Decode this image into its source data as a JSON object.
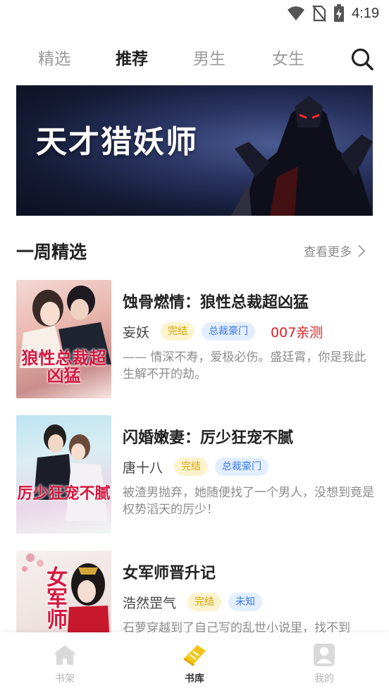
{
  "status_bar": {
    "time": "4:19"
  },
  "tabs": [
    {
      "label": "精选",
      "active": false
    },
    {
      "label": "推荐",
      "active": true
    },
    {
      "label": "男生",
      "active": false
    },
    {
      "label": "女生",
      "active": false
    }
  ],
  "banner": {
    "title": "天才猎妖师"
  },
  "section": {
    "title": "一周精选",
    "more_label": "查看更多"
  },
  "books": [
    {
      "title": "蚀骨燃情：狼性总裁超凶猛",
      "author": "妄妖",
      "status_tag": "完结",
      "category_tag": "总裁豪门",
      "note": "007亲测",
      "description": "—— 情深不寿，爱极必伤。盛廷霄，你是我此生解不开的劫。",
      "cover_text": "狼性总裁超凶猛"
    },
    {
      "title": "闪婚嫩妻：厉少狂宠不腻",
      "author": "唐十八",
      "status_tag": "完结",
      "category_tag": "总裁豪门",
      "note": "",
      "description": "被渣男抛弃，她随便找了一个男人，没想到竟是权势滔天的厉少！",
      "cover_text": "厉少狂宠不腻"
    },
    {
      "title": "女军师晋升记",
      "author": "浩然罡气",
      "status_tag": "完结",
      "category_tag": "未知",
      "note": "",
      "description": "石萝穿越到了自己写的乱世小说里，找不到",
      "cover_text": "女军师"
    }
  ],
  "bottom_nav": [
    {
      "label": "书架",
      "icon": "bookshelf-icon",
      "active": false
    },
    {
      "label": "书库",
      "icon": "library-icon",
      "active": true
    },
    {
      "label": "我的",
      "icon": "profile-icon",
      "active": false
    }
  ],
  "colors": {
    "accent": "#f5c518",
    "tag_done_text": "#d8a200",
    "tag_category_text": "#3a7be0",
    "note_red": "#e02020"
  }
}
